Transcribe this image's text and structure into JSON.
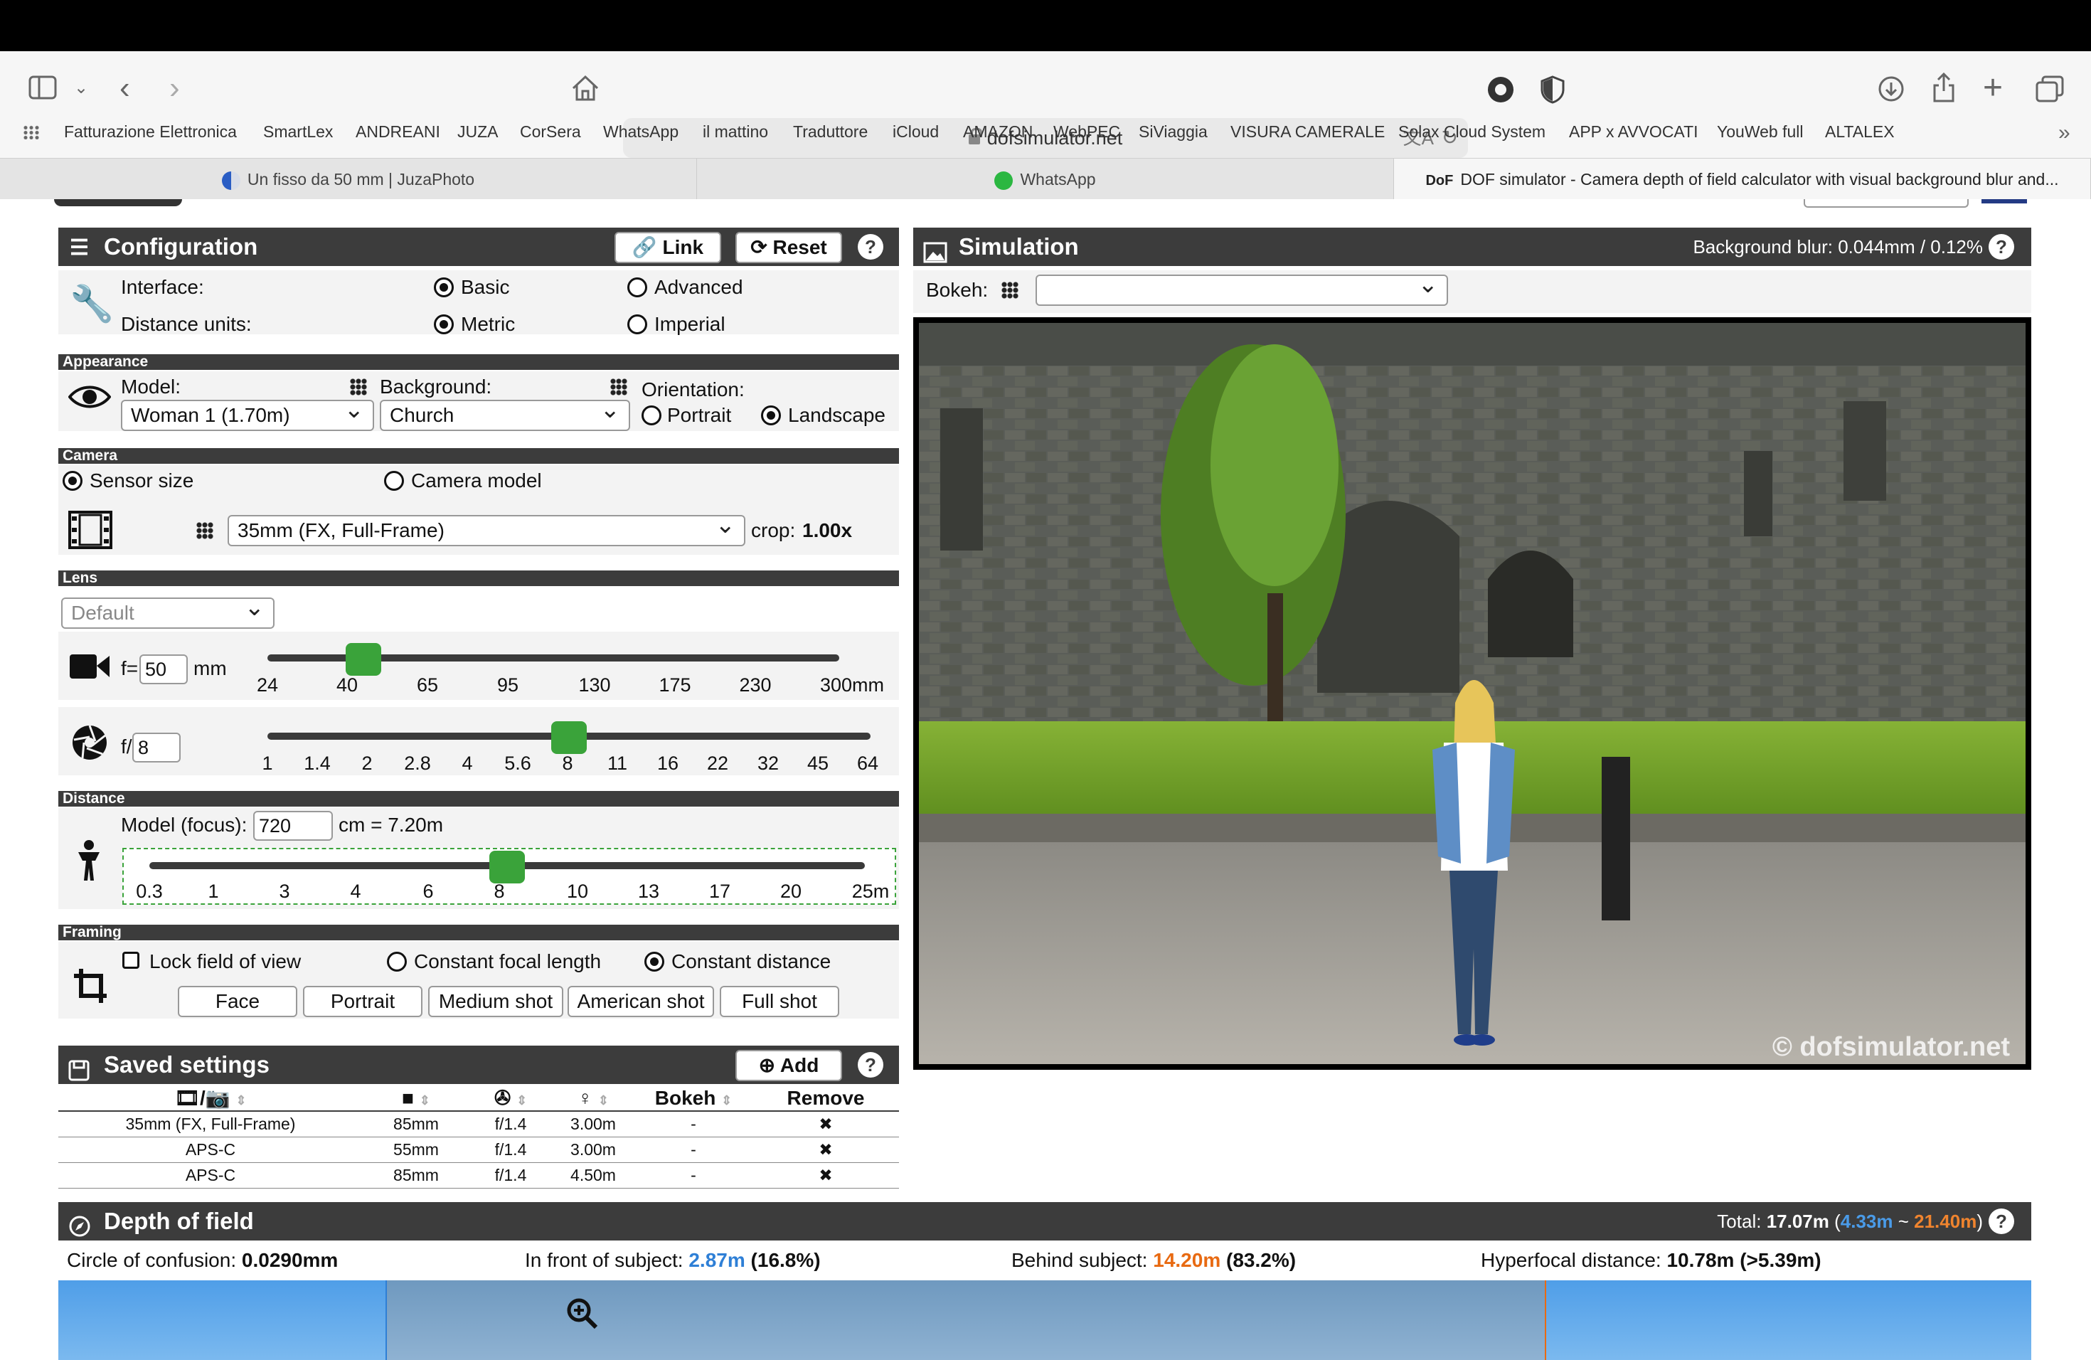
{
  "browser": {
    "url": "dofsimulator.net",
    "bookmarks": [
      "Fatturazione Elettronica",
      "SmartLex",
      "ANDREANI",
      "JUZA",
      "CorSera",
      "WhatsApp",
      "il mattino",
      "Traduttore",
      "iCloud",
      "AMAZON",
      "WebPEC",
      "SiViaggia",
      "VISURA CAMERALE",
      "Solax Cloud System",
      "APP x AVVOCATI",
      "YouWeb full",
      "ALTALEX"
    ],
    "tabs": [
      {
        "label": "Un fisso da 50 mm | JuzaPhoto"
      },
      {
        "label": "WhatsApp"
      },
      {
        "label": "DOF simulator - Camera depth of field calculator with visual background blur and..."
      }
    ]
  },
  "config": {
    "title": "Configuration",
    "link_label": "Link",
    "reset_label": "Reset",
    "interface_label": "Interface:",
    "basic_label": "Basic",
    "advanced_label": "Advanced",
    "units_label": "Distance units:",
    "metric_label": "Metric",
    "imperial_label": "Imperial",
    "appearance_section": "Appearance",
    "model_label": "Model:",
    "model_value": "Woman 1 (1.70m)",
    "background_label": "Background:",
    "background_value": "Church",
    "orientation_label": "Orientation:",
    "portrait_label": "Portrait",
    "landscape_label": "Landscape",
    "camera_section": "Camera",
    "sensor_size_label": "Sensor size",
    "camera_model_label": "Camera model",
    "sensor_value": "35mm (FX, Full-Frame)",
    "crop_label": "crop:",
    "crop_value": "1.00x",
    "lens_section": "Lens",
    "lens_value": "Default",
    "focal_prefix": "f=",
    "focal_value": "50",
    "focal_unit": "mm",
    "focal_ticks": [
      "24",
      "40",
      "65",
      "95",
      "130",
      "175",
      "230",
      "300mm"
    ],
    "aperture_prefix": "f/",
    "aperture_value": "8",
    "aperture_ticks": [
      "1",
      "1.4",
      "2",
      "2.8",
      "4",
      "5.6",
      "8",
      "11",
      "16",
      "22",
      "32",
      "45",
      "64"
    ],
    "distance_section": "Distance",
    "focus_label": "Model (focus):",
    "focus_value": "720",
    "focus_unit": "cm = 7.20m",
    "distance_ticks": [
      "0.3",
      "1",
      "3",
      "4",
      "6",
      "8",
      "10",
      "13",
      "17",
      "20",
      "25m"
    ],
    "framing_section": "Framing",
    "lock_fov_label": "Lock field of view",
    "const_focal_label": "Constant focal length",
    "const_distance_label": "Constant distance",
    "framing_buttons": [
      "Face",
      "Portrait",
      "Medium shot",
      "American shot",
      "Full shot"
    ]
  },
  "saved": {
    "title": "Saved settings",
    "add_label": "Add",
    "bokeh_header": "Bokeh",
    "remove_header": "Remove",
    "rows": [
      {
        "sensor": "35mm (FX, Full-Frame)",
        "focal": "85mm",
        "aperture": "f/1.4",
        "distance": "3.00m",
        "bokeh": "-",
        "remove": "✖"
      },
      {
        "sensor": "APS-C",
        "focal": "55mm",
        "aperture": "f/1.4",
        "distance": "3.00m",
        "bokeh": "-",
        "remove": "✖"
      },
      {
        "sensor": "APS-C",
        "focal": "85mm",
        "aperture": "f/1.4",
        "distance": "4.50m",
        "bokeh": "-",
        "remove": "✖"
      }
    ]
  },
  "simulation": {
    "title": "Simulation",
    "blur_text": "Background blur: 0.044mm / 0.12%",
    "bokeh_label": "Bokeh:",
    "watermark": "© dofsimulator.net"
  },
  "dof": {
    "title": "Depth of field",
    "total_label": "Total:",
    "total_value": "17.07m",
    "near_value": "4.33m",
    "far_value": "21.40m",
    "coc_label": "Circle of confusion:",
    "coc_value": "0.0290mm",
    "front_label": "In front of subject:",
    "front_value": "2.87m",
    "front_pct": "(16.8%)",
    "behind_label": "Behind subject:",
    "behind_value": "14.20m",
    "behind_pct": "(83.2%)",
    "hyper_label": "Hyperfocal distance:",
    "hyper_value": "10.78m (>5.39m)"
  },
  "colors": {
    "near": "#2e7fd6",
    "far": "#e86a12",
    "slider": "#3aa33a",
    "header": "#3c3c3c"
  }
}
